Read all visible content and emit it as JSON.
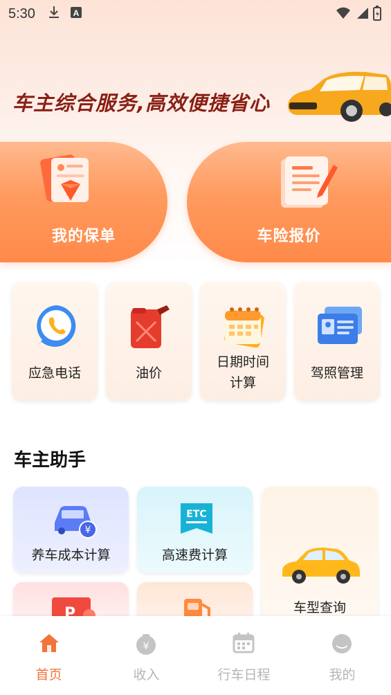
{
  "status_bar": {
    "time": "5:30"
  },
  "hero": {
    "slogan": "车主综合服务,高效便捷省心"
  },
  "main_cards": [
    {
      "label": "我的保单",
      "icon": "policy-gem-icon"
    },
    {
      "label": "车险报价",
      "icon": "quote-document-icon"
    }
  ],
  "tools": [
    {
      "label": "应急电话",
      "icon": "phone-icon"
    },
    {
      "label": "油价",
      "icon": "fuel-can-icon"
    },
    {
      "label_line1": "日期时间",
      "label_line2": "计算",
      "icon": "calendar-icon"
    },
    {
      "label": "驾照管理",
      "icon": "license-card-icon"
    }
  ],
  "assistant": {
    "title": "车主助手",
    "items": [
      {
        "label": "养车成本计算",
        "icon": "car-cost-icon"
      },
      {
        "label": "高速费计算",
        "icon": "etc-icon"
      },
      {
        "label": "车型查询",
        "icon": "yellow-car-icon"
      },
      {
        "label": "",
        "icon": "parking-icon"
      },
      {
        "label": "",
        "icon": "fuel-pump-icon"
      }
    ],
    "etc_text": "ETC"
  },
  "tabbar": [
    {
      "label": "首页",
      "icon": "home-icon",
      "active": true
    },
    {
      "label": "收入",
      "icon": "income-icon",
      "active": false
    },
    {
      "label": "行车日程",
      "icon": "calendar-schedule-icon",
      "active": false
    },
    {
      "label": "我的",
      "icon": "profile-icon",
      "active": false
    }
  ],
  "colors": {
    "accent": "#f2743b",
    "slogan": "#8a1f14",
    "card_orange": "#ff9a5e"
  }
}
